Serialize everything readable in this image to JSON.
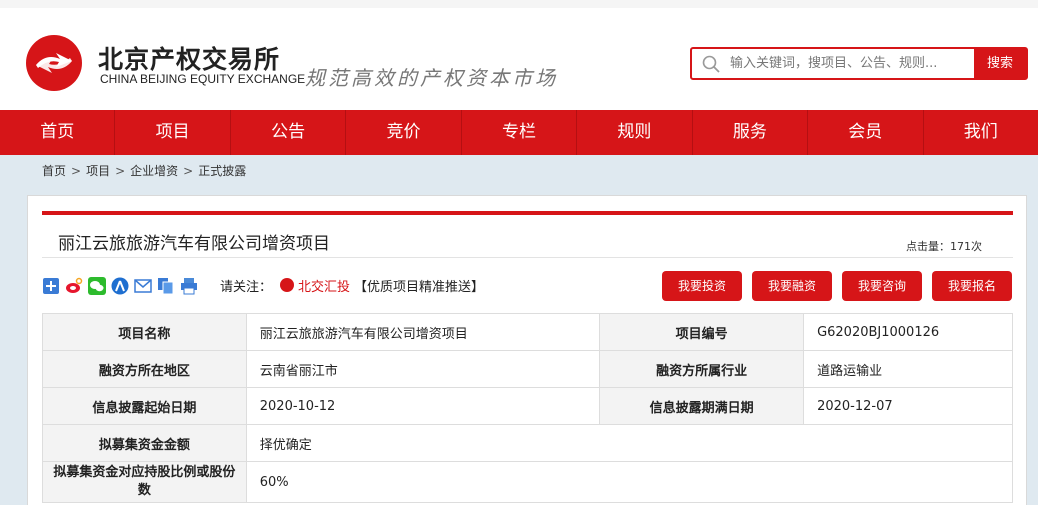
{
  "header": {
    "logo_cn": "北京产权交易所",
    "logo_en": "CHINA BEIJING EQUITY EXCHANGE",
    "slogan": "规范高效的产权资本市场",
    "search_placeholder": "输入关键词，搜项目、公告、规则...",
    "search_button": "搜索",
    "brand_color": "#d61518"
  },
  "nav": [
    "首页",
    "项目",
    "公告",
    "竞价",
    "专栏",
    "规则",
    "服务",
    "会员",
    "我们"
  ],
  "breadcrumb": [
    "首页",
    "项目",
    "企业增资",
    "正式披露"
  ],
  "project": {
    "title": "丽江云旅旅游汽车有限公司增资项目",
    "click_label": "点击量：171次"
  },
  "share": {
    "icons": [
      "add-share-icon",
      "weibo-icon",
      "wechat-icon",
      "renren-icon",
      "email-icon",
      "copy-icon",
      "print-icon"
    ],
    "attention_label": "请关注：",
    "beijiao_link": "北交汇投",
    "beijiao_note": "【优质项目精准推送】"
  },
  "actions": [
    "我要投资",
    "我要融资",
    "我要咨询",
    "我要报名"
  ],
  "table": [
    [
      "项目名称",
      "丽江云旅旅游汽车有限公司增资项目",
      "项目编号",
      "G62020BJ1000126"
    ],
    [
      "融资方所在地区",
      "云南省丽江市",
      "融资方所属行业",
      "道路运输业"
    ],
    [
      "信息披露起始日期",
      "2020-10-12",
      "信息披露期满日期",
      "2020-12-07"
    ],
    [
      "拟募集资金金额",
      "择优确定"
    ],
    [
      "拟募集资金对应持股比例或股份数",
      "60%"
    ]
  ]
}
